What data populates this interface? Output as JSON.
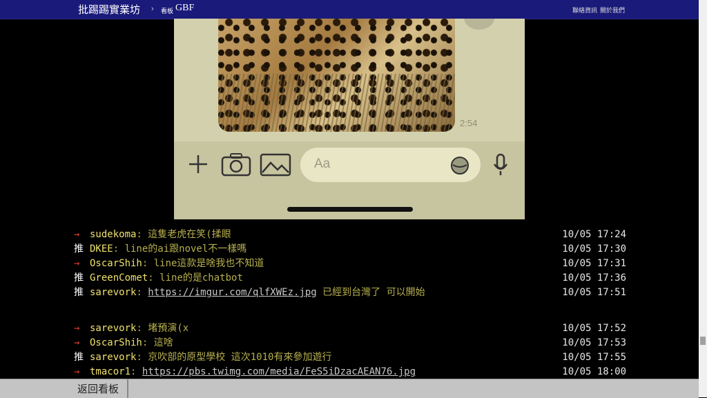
{
  "header": {
    "site_name": "批踢踢實業坊",
    "separator": "›",
    "board_label": "看板",
    "board_name": "GBF",
    "links": [
      "聯絡資訊",
      "關於我們"
    ]
  },
  "phone": {
    "message_time": "2:54",
    "input_placeholder": "Aa"
  },
  "comments": [
    {
      "tag": "→",
      "type": "arrow",
      "user": "sudekoma",
      "content": "這隻老虎在笑(揉眼",
      "link": "",
      "after": "",
      "time": "10/05 17:24"
    },
    {
      "tag": "推",
      "type": "push",
      "user": "DKEE",
      "content": "line的ai跟novel不一樣嗎",
      "link": "",
      "after": "",
      "time": "10/05 17:30"
    },
    {
      "tag": "→",
      "type": "arrow",
      "user": "OscarShih",
      "content": "line這款是啥我也不知道",
      "link": "",
      "after": "",
      "time": "10/05 17:31"
    },
    {
      "tag": "推",
      "type": "push",
      "user": "GreenComet",
      "content": "line的是chatbot",
      "link": "",
      "after": "",
      "time": "10/05 17:36"
    },
    {
      "tag": "推",
      "type": "push",
      "user": "sarevork",
      "content": "",
      "link": "https://imgur.com/qlfXWEz.jpg",
      "after": " 已經到台灣了 可以開始",
      "time": "10/05 17:51"
    },
    {
      "tag": "→",
      "type": "arrow",
      "user": "sarevork",
      "content": "堵預演(x",
      "link": "",
      "after": "",
      "time": "10/05 17:52"
    },
    {
      "tag": "→",
      "type": "arrow",
      "user": "OscarShih",
      "content": "這啥",
      "link": "",
      "after": "",
      "time": "10/05 17:53"
    },
    {
      "tag": "推",
      "type": "push",
      "user": "sarevork",
      "content": "京吹部的原型學校 這次1010有來參加遊行",
      "link": "",
      "after": "",
      "time": "10/05 17:55"
    },
    {
      "tag": "→",
      "type": "arrow",
      "user": "tmacor1",
      "content": "",
      "link": "https://pbs.twimg.com/media/FeS5iDzacAEAN76.jpg",
      "after": "",
      "time": "10/05 18:00"
    }
  ],
  "footer": {
    "back_label": "返回看板"
  }
}
